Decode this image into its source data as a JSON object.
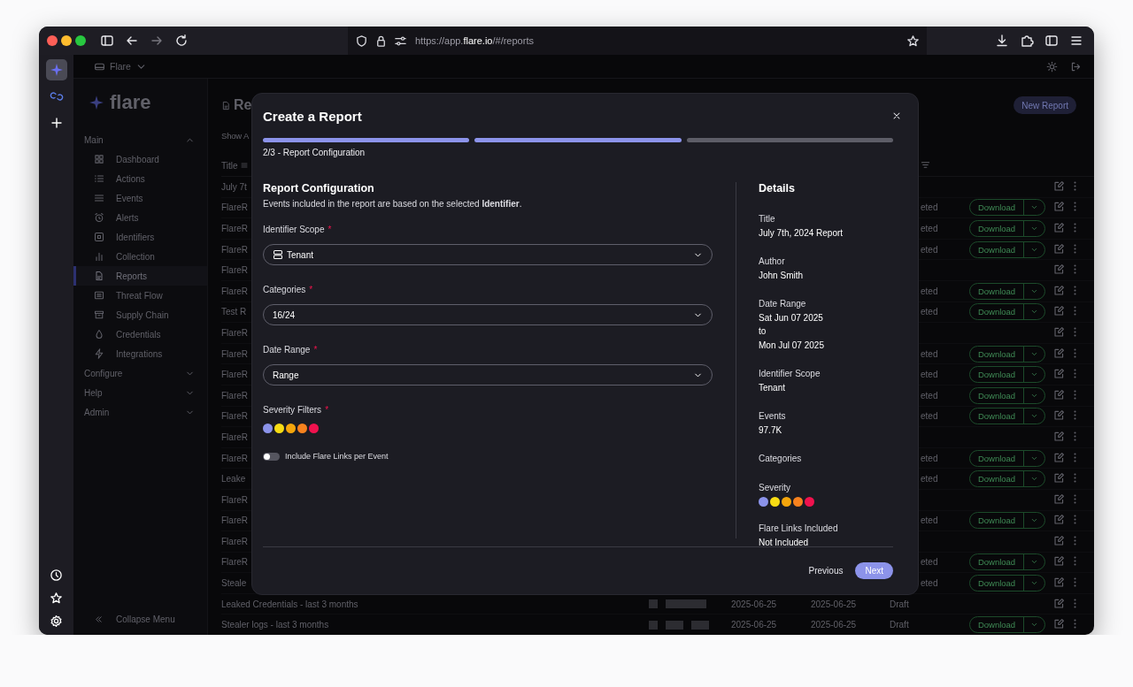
{
  "browser": {
    "url_parts": [
      {
        "text": "https://app.",
        "highlight": false
      },
      {
        "text": "flare.io",
        "highlight": true
      },
      {
        "text": "/#/reports",
        "highlight": false
      }
    ]
  },
  "rail": {
    "top": [
      {
        "selected": true
      },
      {
        "selected": false
      },
      {
        "selected": false
      }
    ]
  },
  "workspace": {
    "name": "Flare"
  },
  "sidebar": {
    "logo": "flare",
    "sections": [
      {
        "title": "Main",
        "expanded": true,
        "items": [
          {
            "label": "Dashboard",
            "selected": false
          },
          {
            "label": "Actions",
            "selected": false
          },
          {
            "label": "Events",
            "selected": false
          },
          {
            "label": "Alerts",
            "selected": false
          },
          {
            "label": "Identifiers",
            "selected": false
          },
          {
            "label": "Collection",
            "selected": false
          },
          {
            "label": "Reports",
            "selected": true
          },
          {
            "label": "Threat Flow",
            "selected": false
          },
          {
            "label": "Supply Chain",
            "selected": false
          },
          {
            "label": "Credentials",
            "selected": false
          },
          {
            "label": "Integrations",
            "selected": false
          }
        ]
      },
      {
        "title": "Configure",
        "expanded": false
      },
      {
        "title": "Help",
        "expanded": false
      },
      {
        "title": "Admin",
        "expanded": false
      }
    ],
    "collapse": "Collapse Menu"
  },
  "page": {
    "title": "Re",
    "new_button": "New Report",
    "show_toggle": "Show A",
    "title_column": "Title"
  },
  "table": {
    "rows": [
      {
        "title": "July 7t"
      },
      {
        "title": "FlareR",
        "status": "eted",
        "download": "Download"
      },
      {
        "title": "FlareR",
        "status": "eted",
        "download": "Download"
      },
      {
        "title": "FlareR",
        "status": "eted",
        "download": "Download"
      },
      {
        "title": "FlareR"
      },
      {
        "title": "FlareR",
        "status": "eted",
        "download": "Download"
      },
      {
        "title": "Test R",
        "status": "eted",
        "download": "Download"
      },
      {
        "title": "FlareR"
      },
      {
        "title": "FlareR",
        "status": "eted",
        "download": "Download"
      },
      {
        "title": "FlareR",
        "status": "eted",
        "download": "Download"
      },
      {
        "title": "FlareR",
        "status": "eted",
        "download": "Download"
      },
      {
        "title": "FlareR",
        "status": "eted",
        "download": "Download"
      },
      {
        "title": "FlareR"
      },
      {
        "title": "FlareR",
        "status": "eted",
        "download": "Download"
      },
      {
        "title": "Leake",
        "status": "eted",
        "download": "Download"
      },
      {
        "title": "FlareR"
      },
      {
        "title": "FlareR",
        "status": "eted",
        "download": "Download"
      },
      {
        "title": "FlareR"
      },
      {
        "title": "FlareR",
        "status": "eted",
        "download": "Download"
      },
      {
        "title": "Steale",
        "status": "eted",
        "download": "Download"
      },
      {
        "title": "Leaked Credentials - last 3 months",
        "created": "2025-06-25",
        "updated": "2025-06-25",
        "status": "Draft"
      },
      {
        "title": "Stealer logs - last 3 months",
        "created": "2025-06-25",
        "updated": "2025-06-25",
        "status": "Draft",
        "download": "Download"
      }
    ]
  },
  "modal": {
    "title": "Create a Report",
    "steps": [
      {
        "done": true
      },
      {
        "done": true
      },
      {
        "done": false
      }
    ],
    "step_label": "2/3 - Report Configuration",
    "section_title": "Report Configuration",
    "description": "Events included in the report are based on the selected **Identifier**.",
    "fields": [
      {
        "kind": "select",
        "label": "Identifier Scope",
        "required_mark": "*",
        "value": "Tenant"
      },
      {
        "kind": "select",
        "label": "Categories",
        "required_mark": "*",
        "value": "16/24"
      },
      {
        "kind": "select",
        "label": "Date Range",
        "required_mark": "*",
        "value": "Range"
      },
      {
        "kind": "dots",
        "label": "Severity Filters",
        "required_mark": "*",
        "dots": [
          {
            "color": "#8b93ea",
            "selected": true
          },
          {
            "color": "#f7dc14",
            "selected": true
          },
          {
            "color": "#f5a60c",
            "selected": true
          },
          {
            "color": "#f7821e",
            "selected": true
          },
          {
            "color": "#f0124e",
            "selected": true
          }
        ]
      },
      {
        "kind": "toggle",
        "label": "Include Flare Links per Event",
        "on": false
      }
    ],
    "details_title": "Details",
    "details": [
      {
        "kind": "text",
        "label": "Title",
        "lines": [
          "July 7th, 2024 Report"
        ]
      },
      {
        "kind": "text",
        "label": "Author",
        "lines": [
          "John Smith"
        ]
      },
      {
        "kind": "text",
        "label": "Date Range",
        "lines": [
          "Sat Jun 07 2025",
          "to",
          "Mon Jul 07 2025"
        ]
      },
      {
        "kind": "text",
        "label": "Identifier Scope",
        "lines": [
          "Tenant"
        ]
      },
      {
        "kind": "text",
        "label": "Events",
        "lines": [
          "97.7K"
        ]
      },
      {
        "kind": "text",
        "label": "Categories"
      },
      {
        "kind": "dots",
        "label": "Severity",
        "dots": [
          {
            "color": "#8b93ea"
          },
          {
            "color": "#f7dc14"
          },
          {
            "color": "#f5a60c"
          },
          {
            "color": "#f7821e"
          },
          {
            "color": "#f0124e"
          }
        ]
      },
      {
        "kind": "text",
        "label": "Flare Links Included",
        "lines": [
          "Not Included"
        ]
      }
    ],
    "previous": "Previous",
    "next": "Next"
  }
}
